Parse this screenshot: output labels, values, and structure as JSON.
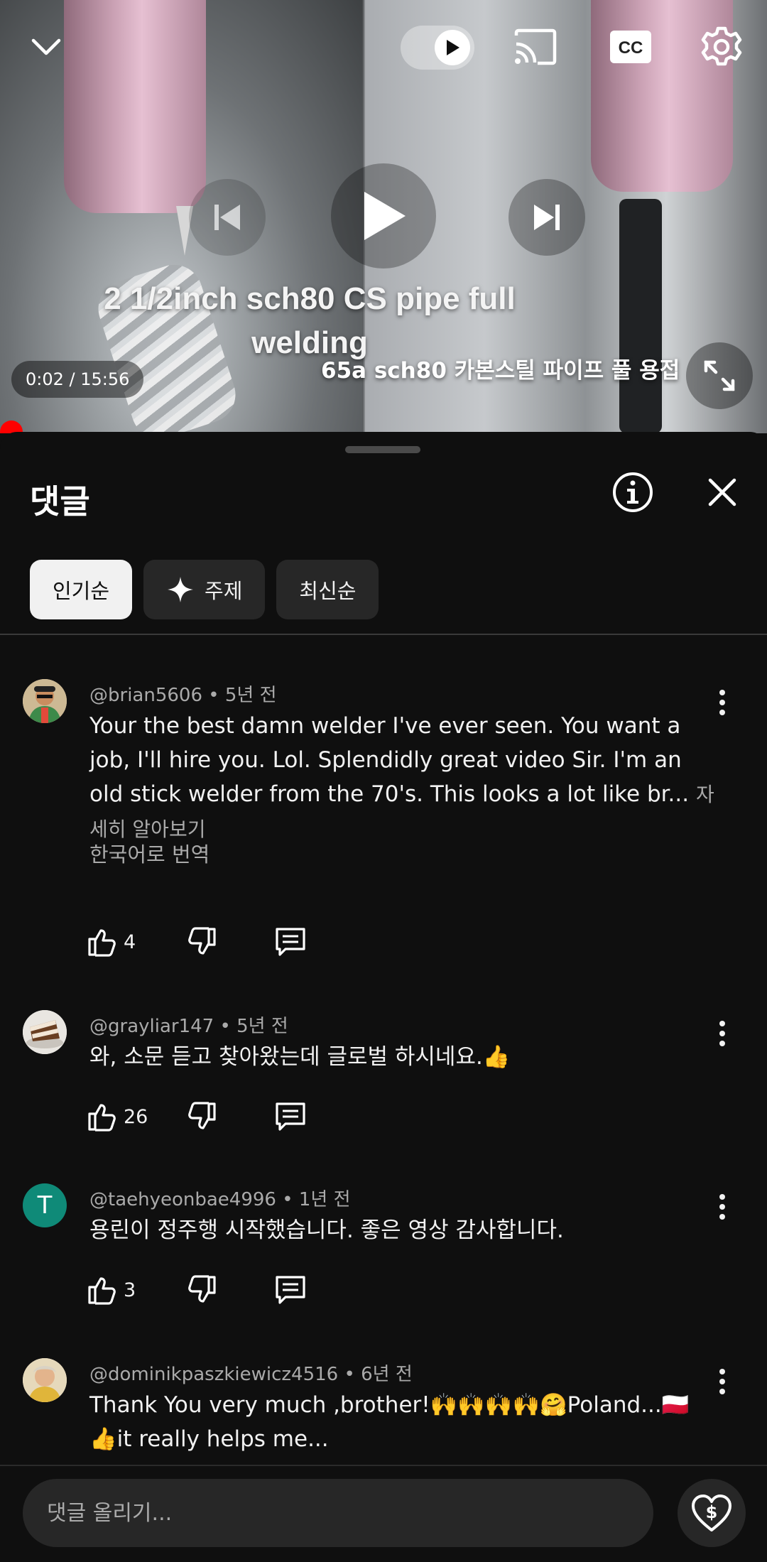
{
  "player": {
    "overlay_title": "2 1/2inch sch80 CS pipe full welding",
    "overlay_subtitle": "65a sch80 카본스틸 파이프 풀 용접",
    "time": "0:02 / 15:56",
    "icons": [
      "chevron-down-icon",
      "autoplay-toggle-icon",
      "cast-icon",
      "cc-icon",
      "gear-icon",
      "previous-icon",
      "play-icon",
      "next-icon",
      "fullscreen-icon"
    ]
  },
  "comments_panel": {
    "title": "댓글",
    "chips": [
      {
        "label": "인기순",
        "active": true
      },
      {
        "label": "주제",
        "active": false
      },
      {
        "label": "최신순",
        "active": false
      }
    ],
    "comments": [
      {
        "author": "@brian5606",
        "time": "5년 전",
        "text": "Your the best damn welder I've ever seen. You want a job, I'll hire you. Lol. Splendidly great video Sir. I'm an old stick welder from the 70's. This looks a lot like br...",
        "more": "자세히 알아보기",
        "translate": "한국어로 번역",
        "likes": "4"
      },
      {
        "author": "@grayliar147",
        "time": "5년 전",
        "text": "와, 소문 듣고 찾아왔는데 글로벌 하시네요.👍",
        "likes": "26"
      },
      {
        "author": "@taehyeonbae4996",
        "time": "1년 전",
        "avatar_letter": "T",
        "text": "용린이 정주행 시작했습니다. 좋은 영상 감사합니다.",
        "likes": "3"
      },
      {
        "author": "@dominikpaszkiewicz4516",
        "time": "6년 전",
        "text": "Thank You very much ,brother!🙌🙌🙌🙌🤗Poland...🇵🇱👍it really helps me..."
      }
    ],
    "meta_separator": "•"
  },
  "input": {
    "placeholder": "댓글 올리기..."
  },
  "colors": {
    "background": "#0f0f0f",
    "chip": "#272727",
    "chip_active": "#f1f1f1",
    "secondary_text": "#aaaaaa",
    "progress": "#ff0000",
    "avatar_t": "#0f8a78"
  }
}
